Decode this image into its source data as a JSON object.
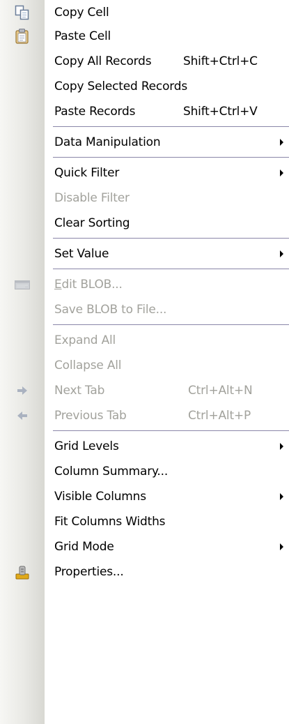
{
  "menu": {
    "copy_cell": {
      "label": "Copy Cell",
      "icon": "copy-icon"
    },
    "paste_cell": {
      "label": "Paste Cell",
      "icon": "paste-icon"
    },
    "copy_all_records": {
      "label": "Copy All Records",
      "shortcut": "Shift+Ctrl+C"
    },
    "copy_selected_records": {
      "label": "Copy Selected Records"
    },
    "paste_records": {
      "label": "Paste Records",
      "shortcut": "Shift+Ctrl+V"
    },
    "data_manipulation": {
      "label": "Data Manipulation"
    },
    "quick_filter": {
      "label": "Quick Filter"
    },
    "disable_filter": {
      "label": "Disable Filter"
    },
    "clear_sorting": {
      "label": "Clear Sorting"
    },
    "set_value": {
      "label": "Set Value"
    },
    "edit_blob": {
      "label_first": "E",
      "label_rest": "dit BLOB...",
      "icon": "blob-editor-icon"
    },
    "save_blob": {
      "label": "Save BLOB to File..."
    },
    "expand_all": {
      "label": "Expand All"
    },
    "collapse_all": {
      "label": "Collapse All"
    },
    "next_tab": {
      "label": "Next Tab",
      "shortcut": "Ctrl+Alt+N",
      "icon": "arrow-right-icon"
    },
    "previous_tab": {
      "label": "Previous Tab",
      "shortcut": "Ctrl+Alt+P",
      "icon": "arrow-left-icon"
    },
    "grid_levels": {
      "label": "Grid Levels"
    },
    "column_summary": {
      "label": "Column Summary..."
    },
    "visible_columns": {
      "label": "Visible Columns"
    },
    "fit_columns_widths": {
      "label": "Fit Columns Widths"
    },
    "grid_mode": {
      "label": "Grid Mode"
    },
    "properties": {
      "label": "Properties...",
      "icon": "properties-icon"
    }
  },
  "colors": {
    "text": "#000000",
    "disabled_text": "#a2a29c",
    "separator": "#8a86a8",
    "gutter": "#e9e9e5"
  }
}
